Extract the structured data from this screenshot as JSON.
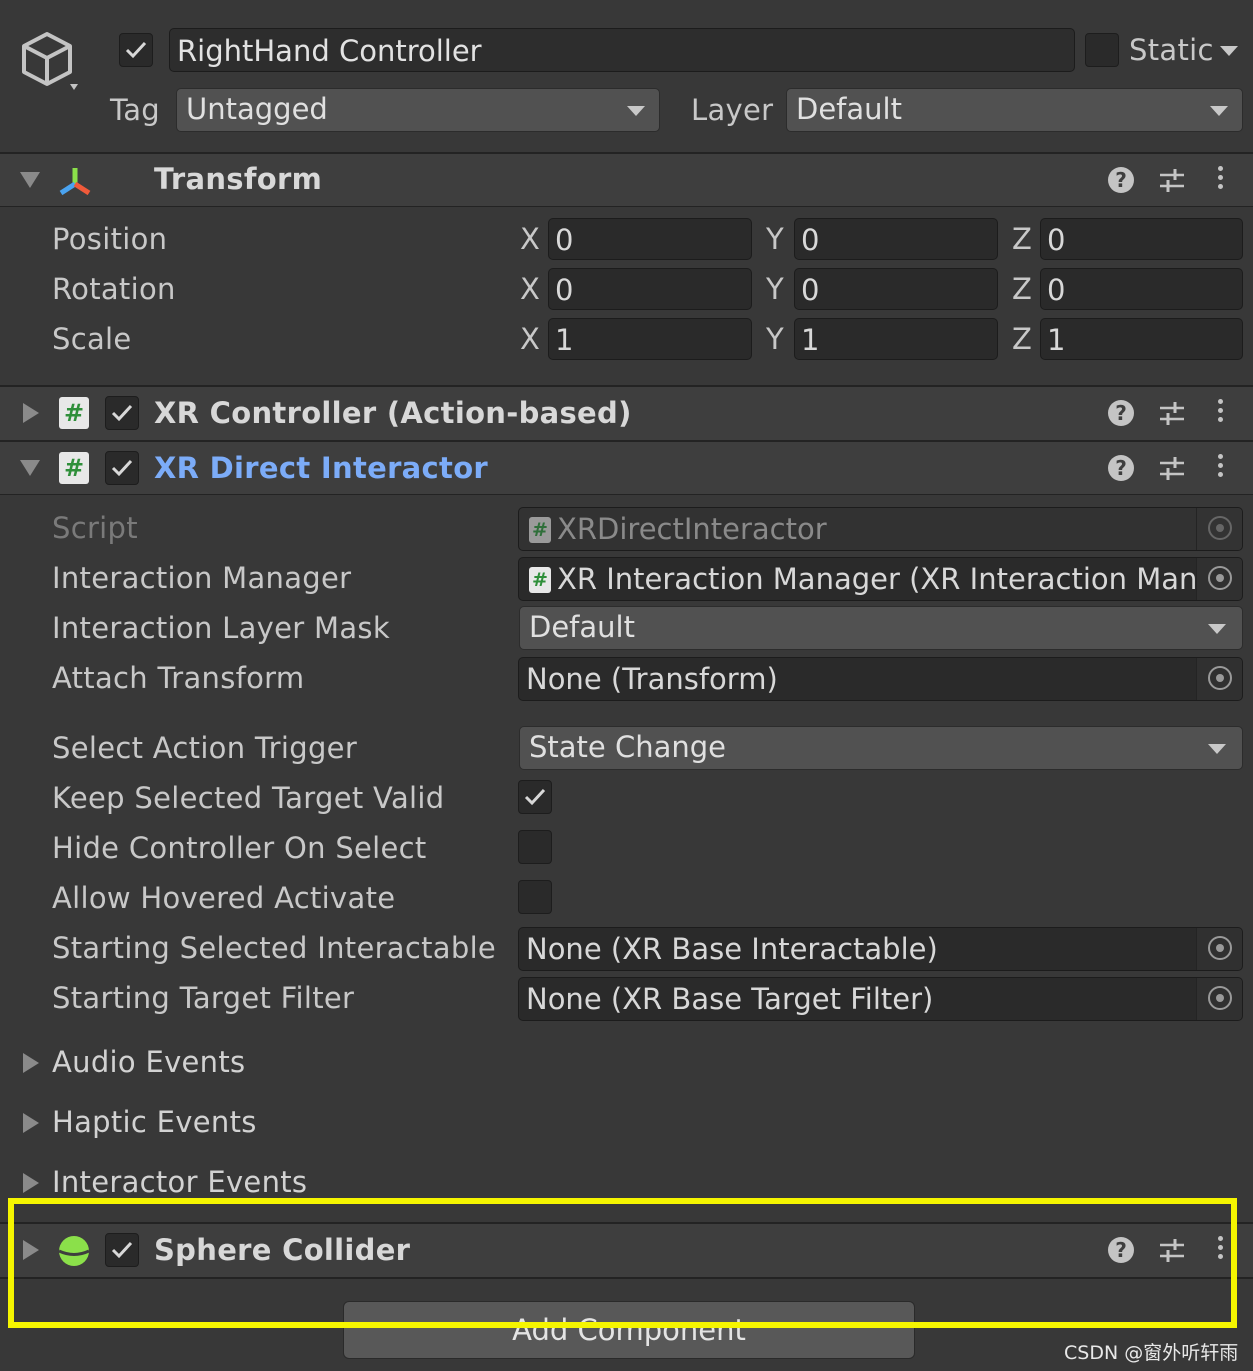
{
  "object": {
    "name": "RightHand Controller",
    "active": true,
    "static_label": "Static",
    "static_checked": false,
    "tag_label": "Tag",
    "tag_value": "Untagged",
    "layer_label": "Layer",
    "layer_value": "Default"
  },
  "transform": {
    "title": "Transform",
    "rows": [
      {
        "label": "Position",
        "x": "0",
        "y": "0",
        "z": "0"
      },
      {
        "label": "Rotation",
        "x": "0",
        "y": "0",
        "z": "0"
      },
      {
        "label": "Scale",
        "x": "1",
        "y": "1",
        "z": "1"
      }
    ],
    "axes": {
      "x": "X",
      "y": "Y",
      "z": "Z"
    }
  },
  "xr_controller": {
    "title": "XR Controller (Action-based)",
    "enabled": true
  },
  "xr_direct": {
    "title": "XR Direct Interactor",
    "enabled": true,
    "title_color": "#7cacf8",
    "script_label": "Script",
    "script_value": "XRDirectInteractor",
    "interaction_manager_label": "Interaction Manager",
    "interaction_manager_value": "XR Interaction Manager (XR Interaction Mana",
    "layer_mask_label": "Interaction Layer Mask",
    "layer_mask_value": "Default",
    "attach_label": "Attach Transform",
    "attach_value": "None (Transform)",
    "select_trigger_label": "Select Action Trigger",
    "select_trigger_value": "State Change",
    "keep_selected_label": "Keep Selected Target Valid",
    "keep_selected_checked": true,
    "hide_controller_label": "Hide Controller On Select",
    "hide_controller_checked": false,
    "allow_hovered_label": "Allow Hovered Activate",
    "allow_hovered_checked": false,
    "starting_selected_label": "Starting Selected Interactable",
    "starting_selected_value": "None (XR Base Interactable)",
    "starting_filter_label": "Starting Target Filter",
    "starting_filter_value": "None (XR Base Target Filter)",
    "foldouts": [
      "Audio Events",
      "Haptic Events",
      "Interactor Events"
    ]
  },
  "sphere_collider": {
    "title": "Sphere Collider",
    "enabled": true,
    "icon_color": "#8be04a"
  },
  "add_component_label": "Add Component",
  "highlight_color": "#f5f500",
  "watermark": "CSDN @窗外听轩雨"
}
